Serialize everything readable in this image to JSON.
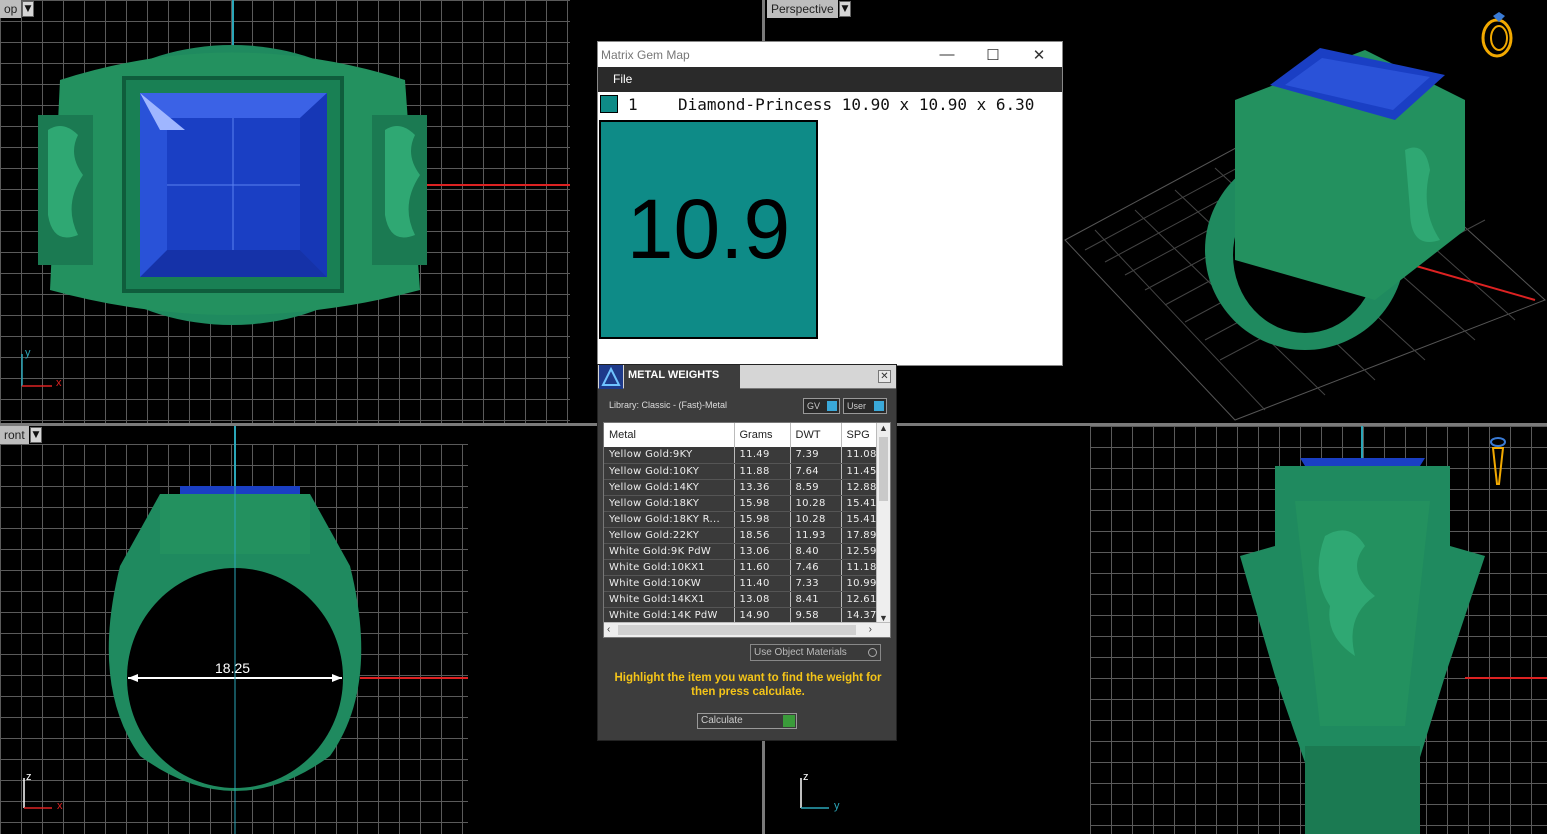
{
  "viewports": {
    "top": {
      "label": "op"
    },
    "perspective": {
      "label": "Perspective"
    },
    "front": {
      "label": "ront",
      "measurement": "18.25"
    },
    "right": {
      "label": ""
    }
  },
  "axes": {
    "x": "x",
    "y": "y",
    "z": "z"
  },
  "gem_map": {
    "title": "Matrix Gem Map",
    "menu_file": "File",
    "row_index": "1",
    "row_desc": "Diamond-Princess 10.90 x 10.90 x 6.30",
    "big_value": "10.9",
    "swatch_color": "#0e8b87"
  },
  "metal_weights": {
    "title": "METAL WEIGHTS",
    "library": "Library: Classic - (Fast)-Metal",
    "toggle_gv": "GV",
    "toggle_user": "User",
    "columns": [
      "Metal",
      "Grams",
      "DWT",
      "SPG"
    ],
    "rows": [
      [
        "Yellow Gold:9KY",
        "11.49",
        "7.39",
        "11.08"
      ],
      [
        "Yellow Gold:10KY",
        "11.88",
        "7.64",
        "11.45"
      ],
      [
        "Yellow Gold:14KY",
        "13.36",
        "8.59",
        "12.88"
      ],
      [
        "Yellow Gold:18KY",
        "15.98",
        "10.28",
        "15.41"
      ],
      [
        "Yellow Gold:18KY R...",
        "15.98",
        "10.28",
        "15.41"
      ],
      [
        "Yellow Gold:22KY",
        "18.56",
        "11.93",
        "17.89"
      ],
      [
        "White Gold:9K PdW",
        "13.06",
        "8.40",
        "12.59"
      ],
      [
        "White Gold:10KX1",
        "11.60",
        "7.46",
        "11.18"
      ],
      [
        "White Gold:10KW",
        "11.40",
        "7.33",
        "10.99"
      ],
      [
        "White Gold:14KX1",
        "13.08",
        "8.41",
        "12.61"
      ],
      [
        "White Gold:14K PdW",
        "14.90",
        "9.58",
        "14.37"
      ]
    ],
    "use_object_materials": "Use Object Materials",
    "instructions": "Highlight the item you want to find the weight for then press calculate.",
    "calculate": "Calculate"
  }
}
